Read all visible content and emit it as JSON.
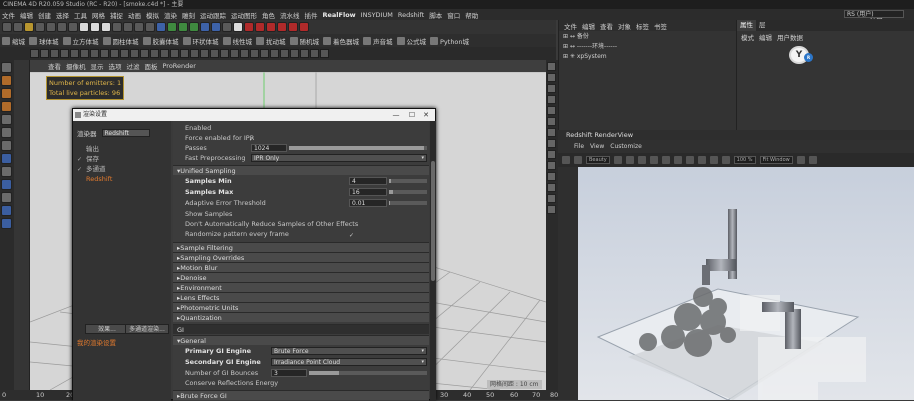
{
  "window": {
    "title": "CINEMA 4D R20.059 Studio (RC - R20) - [smoke.c4d *] - 主要"
  },
  "menubar": {
    "items": [
      "文件",
      "编辑",
      "创建",
      "选择",
      "工具",
      "网格",
      "捕捉",
      "动画",
      "模拟",
      "渲染",
      "雕刻",
      "运动跟踪",
      "运动图形",
      "角色",
      "流水线",
      "插件"
    ],
    "realflow": "RealFlow",
    "items2": [
      "INSYDIUM",
      "Redshift",
      "脚本",
      "窗口",
      "帮助"
    ],
    "interface_label": "界面:",
    "interface_value": "RS (用户)"
  },
  "plugin_bar": {
    "items": [
      "缩城",
      "球体城",
      "立方体城",
      "圆柱体城",
      "胶囊体城",
      "环状体城",
      "线性城",
      "扰动城",
      "随机城",
      "着色器城",
      "声音城",
      "公式城",
      "Python城"
    ]
  },
  "viewport": {
    "menu": [
      "查看",
      "摄像机",
      "显示",
      "选项",
      "过滤",
      "面板",
      "ProRender"
    ],
    "emitters_label": "Number of emitters: 1",
    "particles_label": "Total live particles: 96",
    "scale_label": "网格间距 : 10 cm"
  },
  "timeline": {
    "ticks": [
      "0",
      "10",
      "20",
      "30",
      "40",
      "50",
      "60",
      "70",
      "80"
    ]
  },
  "dialog": {
    "title": "渲染设置",
    "renderer_label": "渲染器",
    "renderer_value": "Redshift",
    "nav": [
      {
        "label": "输出",
        "check": ""
      },
      {
        "label": "保存",
        "check": "✓"
      },
      {
        "label": "多通道",
        "check": "✓"
      },
      {
        "label": "Redshift",
        "check": ""
      }
    ],
    "effect_button": "效果...",
    "multipass_button": "多通道渲染...",
    "my_settings": "我的渲染设置",
    "rows": {
      "enabled": "Enabled",
      "force_ipr": "Force enabled for IPR",
      "force_ipr_check": "✓",
      "passes_label": "Passes",
      "passes_value": "1024",
      "fast_preprocessing": "Fast Preprocessing",
      "fast_preprocessing_value": "IPR Only",
      "unified_sampling": "Unified Sampling",
      "samples_min": "Samples Min",
      "samples_min_value": "4",
      "samples_max": "Samples Max",
      "samples_max_value": "16",
      "adaptive_threshold": "Adaptive Error Threshold",
      "adaptive_threshold_value": "0.01",
      "show_samples": "Show Samples",
      "dont_reduce": "Don't Automatically Reduce Samples of Other Effects",
      "randomize": "Randomize pattern every frame",
      "randomize_check": "✓",
      "sample_filtering": "Sample Filtering",
      "sampling_overrides": "Sampling Overrides",
      "motion_blur": "Motion Blur",
      "denoise": "Denoise",
      "environment": "Environment",
      "lens_effects": "Lens Effects",
      "photometric_units": "Photometric Units",
      "quantization": "Quantization",
      "gi": "GI",
      "general": "General",
      "primary_gi": "Primary GI Engine",
      "primary_gi_value": "Brute Force",
      "secondary_gi": "Secondary GI Engine",
      "secondary_gi_value": "Irradiance Point Cloud",
      "gi_bounces": "Number of GI Bounces",
      "gi_bounces_value": "3",
      "conserve": "Conserve Reflections Energy",
      "brute_force": "Brute Force GI"
    },
    "levels": {
      "passes": 0.98,
      "samples_min": 0.05,
      "samples_max": 0.1,
      "adaptive": 0.02,
      "gi_bounces": 0.25
    }
  },
  "objects": {
    "menu": [
      "文件",
      "编辑",
      "查看",
      "对象",
      "标签",
      "书签"
    ],
    "rows": [
      "备份",
      "-------环境------",
      "xpSystem"
    ]
  },
  "attributes": {
    "tabs": [
      "属性",
      "层"
    ],
    "menu": [
      "模式",
      "编辑",
      "用户数据"
    ]
  },
  "renderview": {
    "title": "Redshift RenderView",
    "menu": [
      "File",
      "View",
      "Customize"
    ],
    "beauty": "Beauty",
    "zoom": "100 %",
    "fit": "Fit Window"
  }
}
